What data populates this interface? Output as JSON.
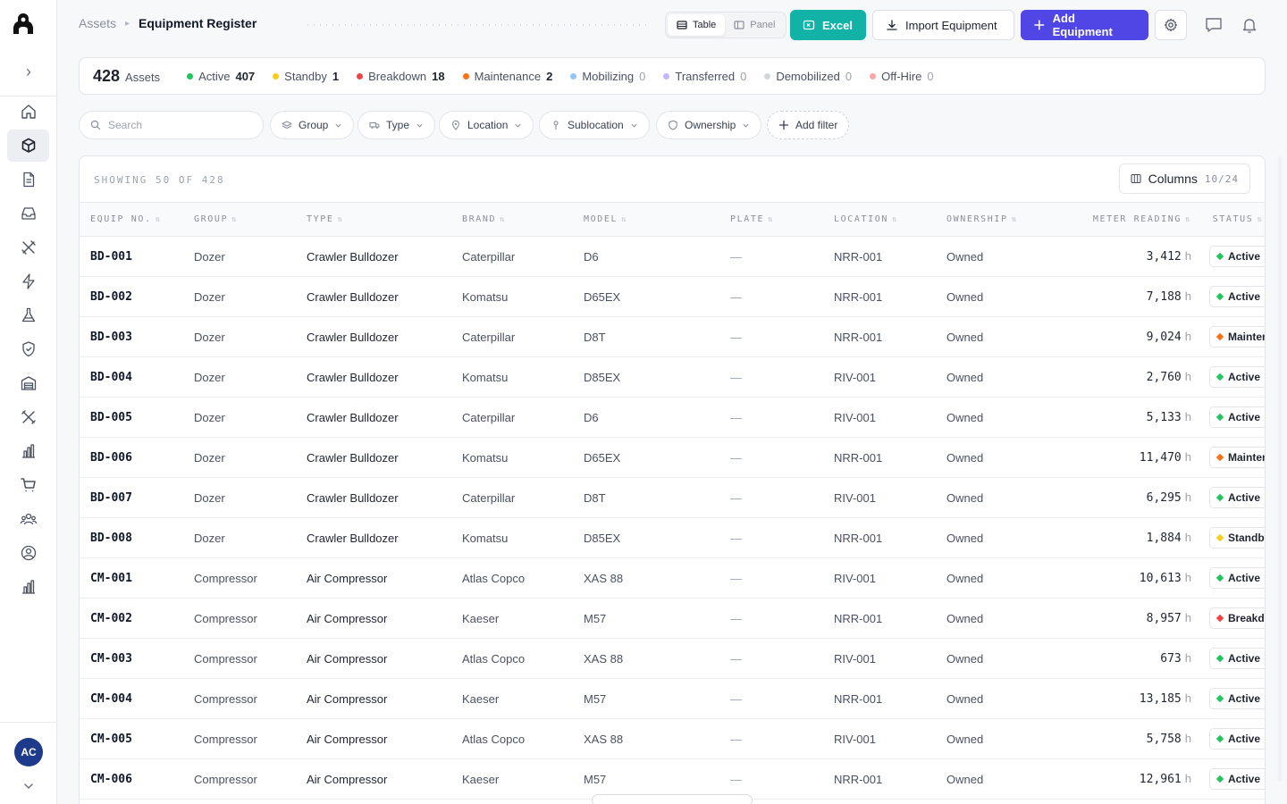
{
  "breadcrumb": {
    "root": "Assets",
    "current": "Equipment Register"
  },
  "view_toggle": {
    "table_label": "Table",
    "panel_label": "Panel",
    "selected": "Table"
  },
  "toolbar": {
    "excel_label": "Excel",
    "import_label": "Import Equipment",
    "add_label": "Add Equipment"
  },
  "colors": {
    "accent": "#4f46e5",
    "excel": "#12b3a6",
    "active": "#22c55e",
    "standby": "#facc15",
    "breakdown": "#ef4444",
    "maintenance": "#f97316",
    "mobilizing": "#93c5fd",
    "transferred": "#c4b5fd",
    "demobilized": "#d1d5db",
    "offhire": "#fca5a5"
  },
  "stats": {
    "total": "428",
    "total_label": "Assets",
    "items": [
      {
        "label": "Active",
        "count": "407",
        "color": "#22c55e"
      },
      {
        "label": "Standby",
        "count": "1",
        "color": "#facc15"
      },
      {
        "label": "Breakdown",
        "count": "18",
        "color": "#ef4444"
      },
      {
        "label": "Maintenance",
        "count": "2",
        "color": "#f97316"
      },
      {
        "label": "Mobilizing",
        "count": "0",
        "color": "#93c5fd"
      },
      {
        "label": "Transferred",
        "count": "0",
        "color": "#c4b5fd"
      },
      {
        "label": "Demobilized",
        "count": "0",
        "color": "#d1d5db"
      },
      {
        "label": "Off-Hire",
        "count": "0",
        "color": "#fca5a5"
      }
    ]
  },
  "search": {
    "placeholder": "Search"
  },
  "filters": {
    "group": "Group",
    "type": "Type",
    "location": "Location",
    "sublocation": "Sublocation",
    "ownership": "Ownership",
    "add": "Add filter"
  },
  "table": {
    "showing": "SHOWING 50 OF 428",
    "columns_label": "Columns",
    "columns_count": "10/24",
    "headers": [
      "EQUIP NO.",
      "GROUP",
      "TYPE",
      "BRAND",
      "MODEL",
      "PLATE",
      "LOCATION",
      "OWNERSHIP",
      "METER READING",
      "STATUS"
    ],
    "meter_unit": "h",
    "rows": [
      {
        "equip": "BD-001",
        "group": "Dozer",
        "type": "Crawler Bulldozer",
        "brand": "Caterpillar",
        "model": "D6",
        "plate": "—",
        "location": "NRR-001",
        "ownership": "Owned",
        "meter": "3,412",
        "status": "Active"
      },
      {
        "equip": "BD-002",
        "group": "Dozer",
        "type": "Crawler Bulldozer",
        "brand": "Komatsu",
        "model": "D65EX",
        "plate": "—",
        "location": "NRR-001",
        "ownership": "Owned",
        "meter": "7,188",
        "status": "Active"
      },
      {
        "equip": "BD-003",
        "group": "Dozer",
        "type": "Crawler Bulldozer",
        "brand": "Caterpillar",
        "model": "D8T",
        "plate": "—",
        "location": "NRR-001",
        "ownership": "Owned",
        "meter": "9,024",
        "status": "Maintenance"
      },
      {
        "equip": "BD-004",
        "group": "Dozer",
        "type": "Crawler Bulldozer",
        "brand": "Komatsu",
        "model": "D85EX",
        "plate": "—",
        "location": "RIV-001",
        "ownership": "Owned",
        "meter": "2,760",
        "status": "Active"
      },
      {
        "equip": "BD-005",
        "group": "Dozer",
        "type": "Crawler Bulldozer",
        "brand": "Caterpillar",
        "model": "D6",
        "plate": "—",
        "location": "RIV-001",
        "ownership": "Owned",
        "meter": "5,133",
        "status": "Active"
      },
      {
        "equip": "BD-006",
        "group": "Dozer",
        "type": "Crawler Bulldozer",
        "brand": "Komatsu",
        "model": "D65EX",
        "plate": "—",
        "location": "NRR-001",
        "ownership": "Owned",
        "meter": "11,470",
        "status": "Maintenance"
      },
      {
        "equip": "BD-007",
        "group": "Dozer",
        "type": "Crawler Bulldozer",
        "brand": "Caterpillar",
        "model": "D8T",
        "plate": "—",
        "location": "RIV-001",
        "ownership": "Owned",
        "meter": "6,295",
        "status": "Active"
      },
      {
        "equip": "BD-008",
        "group": "Dozer",
        "type": "Crawler Bulldozer",
        "brand": "Komatsu",
        "model": "D85EX",
        "plate": "—",
        "location": "NRR-001",
        "ownership": "Owned",
        "meter": "1,884",
        "status": "Standby"
      },
      {
        "equip": "CM-001",
        "group": "Compressor",
        "type": "Air Compressor",
        "brand": "Atlas Copco",
        "model": "XAS 88",
        "plate": "—",
        "location": "RIV-001",
        "ownership": "Owned",
        "meter": "10,613",
        "status": "Active"
      },
      {
        "equip": "CM-002",
        "group": "Compressor",
        "type": "Air Compressor",
        "brand": "Kaeser",
        "model": "M57",
        "plate": "—",
        "location": "NRR-001",
        "ownership": "Owned",
        "meter": "8,957",
        "status": "Breakdown"
      },
      {
        "equip": "CM-003",
        "group": "Compressor",
        "type": "Air Compressor",
        "brand": "Atlas Copco",
        "model": "XAS 88",
        "plate": "—",
        "location": "RIV-001",
        "ownership": "Owned",
        "meter": "673",
        "status": "Active"
      },
      {
        "equip": "CM-004",
        "group": "Compressor",
        "type": "Air Compressor",
        "brand": "Kaeser",
        "model": "M57",
        "plate": "—",
        "location": "NRR-001",
        "ownership": "Owned",
        "meter": "13,185",
        "status": "Active"
      },
      {
        "equip": "CM-005",
        "group": "Compressor",
        "type": "Air Compressor",
        "brand": "Atlas Copco",
        "model": "XAS 88",
        "plate": "—",
        "location": "RIV-001",
        "ownership": "Owned",
        "meter": "5,758",
        "status": "Active"
      },
      {
        "equip": "CM-006",
        "group": "Compressor",
        "type": "Air Compressor",
        "brand": "Kaeser",
        "model": "M57",
        "plate": "—",
        "location": "NRR-001",
        "ownership": "Owned",
        "meter": "12,961",
        "status": "Active"
      }
    ]
  },
  "user": {
    "initials": "AC"
  },
  "sidebar": {
    "icons": [
      "home-icon",
      "cube-icon",
      "document-icon",
      "inbox-icon",
      "tools-icon",
      "bolt-icon",
      "flask-icon",
      "shield-icon",
      "warehouse-icon",
      "wrench-screwdriver-icon",
      "bar-chart-icon",
      "cart-icon",
      "team-icon",
      "user-circle-icon",
      "reports-icon"
    ]
  }
}
